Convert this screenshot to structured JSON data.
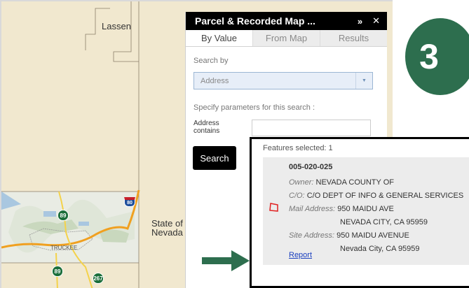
{
  "map": {
    "labels": {
      "lassen": "Lassen",
      "state_line1": "State of",
      "state_line2": "Nevada",
      "truckee": "TRUCKEE"
    },
    "shields": [
      "89",
      "89",
      "267"
    ],
    "interstate": "80",
    "colors": {
      "land": "#f1e8cf",
      "terrain": "#e8ebe3",
      "highway": "#f0a020"
    }
  },
  "panel": {
    "title": "Parcel & Recorded Map ...",
    "collapse_icon": "double-chevron-up-icon",
    "close_icon": "close-icon",
    "tabs": [
      "By Value",
      "From Map",
      "Results"
    ],
    "search_by_label": "Search by",
    "search_by_value": "Address",
    "params_label": "Specify parameters for this search :",
    "address_label_line1": "Address",
    "address_label_line2": "contains",
    "address_value": "",
    "search_button": "Search"
  },
  "badge": {
    "step": "3",
    "color": "#2d6e4e"
  },
  "results": {
    "features_selected": "Features selected: 1",
    "apn": "005-020-025",
    "owner_label": "Owner:",
    "owner": "NEVADA COUNTY OF",
    "co_label": "C/O:",
    "co": "C/O DEPT OF INFO & GENERAL SERVICES",
    "mail_label": "Mail Address:",
    "mail_line1": "950 MAIDU AVE",
    "mail_line2": "NEVADA CITY, CA 95959",
    "site_label": "Site Address:",
    "site_line1": "950 MAIDU AVENUE",
    "site_line2": "Nevada City, CA 95959",
    "report_link": "Report"
  }
}
